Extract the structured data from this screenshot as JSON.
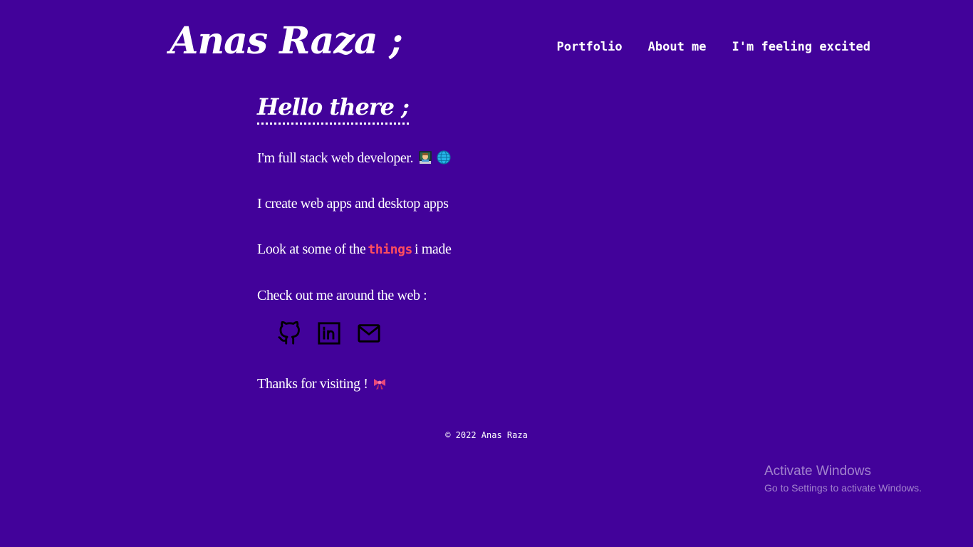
{
  "header": {
    "site_title": "Anas Raza ;",
    "nav": [
      {
        "label": "Portfolio"
      },
      {
        "label": "About me"
      },
      {
        "label": "I'm feeling excited"
      }
    ]
  },
  "main": {
    "heading": "Hello there ;",
    "intro": {
      "text": "I'm full stack web developer.",
      "icons": [
        "technologist-emoji",
        "globe-emoji"
      ]
    },
    "create_text": "I create web apps and desktop apps",
    "things": {
      "before": "Look at some of the",
      "link": "things",
      "after": "i made"
    },
    "social_heading": "Check out me around the web :",
    "social": [
      {
        "icon": "github-icon"
      },
      {
        "icon": "linkedin-icon"
      },
      {
        "icon": "mail-icon"
      }
    ],
    "thanks": {
      "text": "Thanks for visiting !",
      "icon": "ribbon-emoji"
    }
  },
  "footer": {
    "copyright": "© 2022 Anas Raza"
  },
  "os_watermark": {
    "title": "Activate Windows",
    "subtitle": "Go to Settings to activate Windows."
  },
  "colors": {
    "background": "#42029a",
    "text": "#ffffff",
    "accent_link": "#ff4d5e",
    "icon": "#000000"
  }
}
